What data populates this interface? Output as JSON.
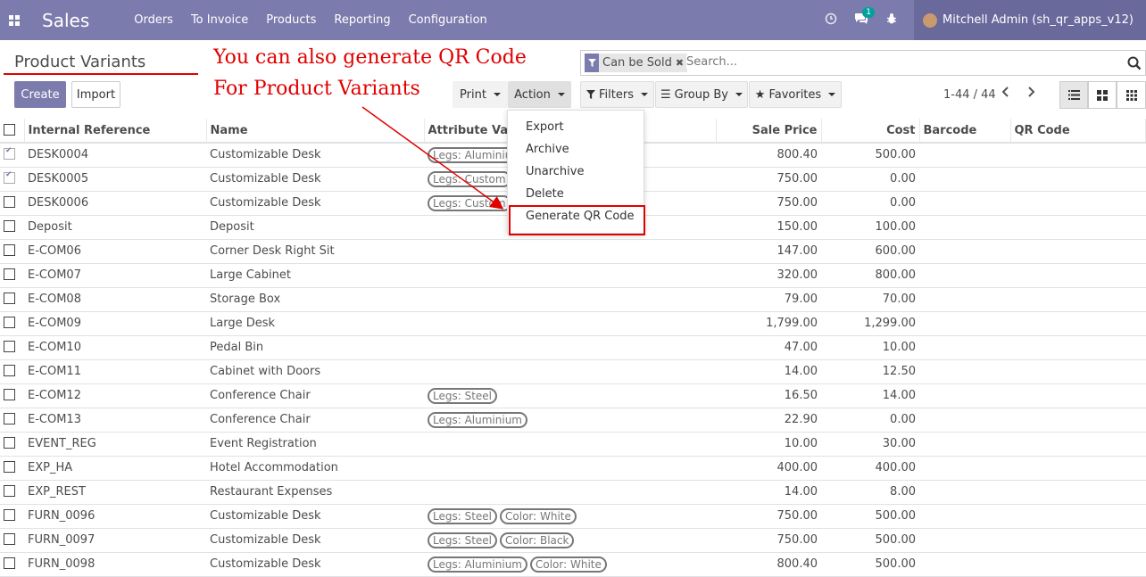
{
  "navbar": {
    "app_name": "Sales",
    "menu": [
      "Orders",
      "To Invoice",
      "Products",
      "Reporting",
      "Configuration"
    ],
    "chat_badge": "1",
    "user": "Mitchell Admin (sh_qr_apps_v12)"
  },
  "breadcrumb": "Product Variants",
  "annotation": {
    "line1": "You can also generate QR Code",
    "line2": "For Product Variants"
  },
  "buttons": {
    "create": "Create",
    "import": "Import",
    "print": "Print",
    "action": "Action",
    "filters": "Filters",
    "group_by": "Group By",
    "favorites": "Favorites"
  },
  "search": {
    "facet": "Can be Sold",
    "placeholder": "Search..."
  },
  "pager": "1-44 / 44",
  "action_menu": [
    "Export",
    "Archive",
    "Unarchive",
    "Delete",
    "Generate QR Code"
  ],
  "table": {
    "columns": [
      "Internal Reference",
      "Name",
      "Attribute Values",
      "Sale Price",
      "Cost",
      "Barcode",
      "QR Code"
    ],
    "rows": [
      {
        "ref": "DESK0004",
        "name": "Customizable Desk",
        "tags": [
          "Legs: Aluminium"
        ],
        "price": "800.40",
        "cost": "500.00",
        "checked": true
      },
      {
        "ref": "DESK0005",
        "name": "Customizable Desk",
        "tags": [
          "Legs: Custom"
        ],
        "price": "750.00",
        "cost": "0.00",
        "checked": true
      },
      {
        "ref": "DESK0006",
        "name": "Customizable Desk",
        "tags": [
          "Legs: Custom"
        ],
        "price": "750.00",
        "cost": "0.00",
        "checked": false
      },
      {
        "ref": "Deposit",
        "name": "Deposit",
        "tags": [],
        "price": "150.00",
        "cost": "100.00",
        "checked": false
      },
      {
        "ref": "E-COM06",
        "name": "Corner Desk Right Sit",
        "tags": [],
        "price": "147.00",
        "cost": "600.00",
        "checked": false
      },
      {
        "ref": "E-COM07",
        "name": "Large Cabinet",
        "tags": [],
        "price": "320.00",
        "cost": "800.00",
        "checked": false
      },
      {
        "ref": "E-COM08",
        "name": "Storage Box",
        "tags": [],
        "price": "79.00",
        "cost": "70.00",
        "checked": false
      },
      {
        "ref": "E-COM09",
        "name": "Large Desk",
        "tags": [],
        "price": "1,799.00",
        "cost": "1,299.00",
        "checked": false
      },
      {
        "ref": "E-COM10",
        "name": "Pedal Bin",
        "tags": [],
        "price": "47.00",
        "cost": "10.00",
        "checked": false
      },
      {
        "ref": "E-COM11",
        "name": "Cabinet with Doors",
        "tags": [],
        "price": "14.00",
        "cost": "12.50",
        "checked": false
      },
      {
        "ref": "E-COM12",
        "name": "Conference Chair",
        "tags": [
          "Legs: Steel"
        ],
        "price": "16.50",
        "cost": "14.00",
        "checked": false
      },
      {
        "ref": "E-COM13",
        "name": "Conference Chair",
        "tags": [
          "Legs: Aluminium"
        ],
        "price": "22.90",
        "cost": "0.00",
        "checked": false
      },
      {
        "ref": "EVENT_REG",
        "name": "Event Registration",
        "tags": [],
        "price": "10.00",
        "cost": "30.00",
        "checked": false
      },
      {
        "ref": "EXP_HA",
        "name": "Hotel Accommodation",
        "tags": [],
        "price": "400.00",
        "cost": "400.00",
        "checked": false
      },
      {
        "ref": "EXP_REST",
        "name": "Restaurant Expenses",
        "tags": [],
        "price": "14.00",
        "cost": "8.00",
        "checked": false
      },
      {
        "ref": "FURN_0096",
        "name": "Customizable Desk",
        "tags": [
          "Legs: Steel",
          "Color: White"
        ],
        "price": "750.00",
        "cost": "500.00",
        "checked": false
      },
      {
        "ref": "FURN_0097",
        "name": "Customizable Desk",
        "tags": [
          "Legs: Steel",
          "Color: Black"
        ],
        "price": "750.00",
        "cost": "500.00",
        "checked": false
      },
      {
        "ref": "FURN_0098",
        "name": "Customizable Desk",
        "tags": [
          "Legs: Aluminium",
          "Color: White"
        ],
        "price": "800.40",
        "cost": "500.00",
        "checked": false
      }
    ]
  },
  "colors": {
    "brand": "#7c7bad",
    "annotation": "#e00000"
  }
}
